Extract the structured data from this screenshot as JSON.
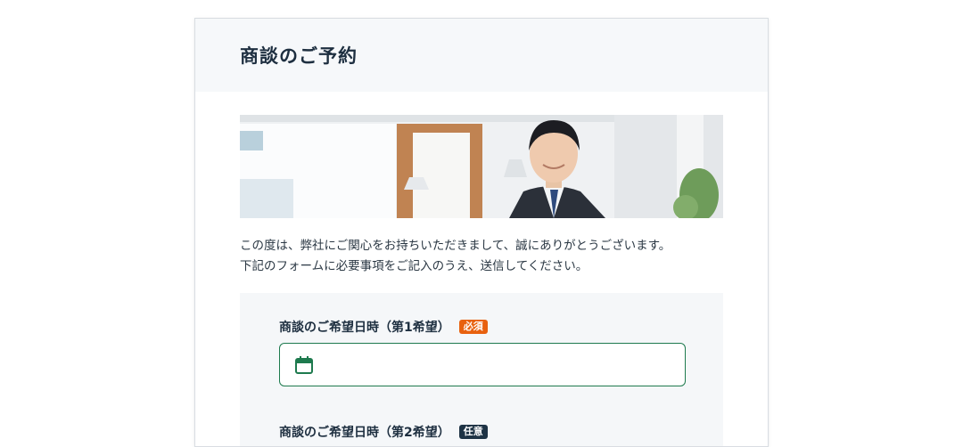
{
  "page_title": "商談のご予約",
  "hero": {
    "description": "",
    "icon": "person-photo"
  },
  "intro": {
    "line1": "この度は、弊社にご関心をお持ちいただきまして、誠にありがとうございます。",
    "line2": "下記のフォームに必要事項をご記入のうえ、送信してください。"
  },
  "form": {
    "field1": {
      "label": "商談のご希望日時（第1希望）",
      "badge": "必須",
      "value": "",
      "placeholder": "",
      "icon": "calendar-icon"
    },
    "field2": {
      "label": "商談のご希望日時（第2希望）",
      "badge": "任意"
    }
  },
  "colors": {
    "required_badge": "#e8610f",
    "optional_badge": "#1e3345",
    "input_border": "#1e7a4e"
  }
}
